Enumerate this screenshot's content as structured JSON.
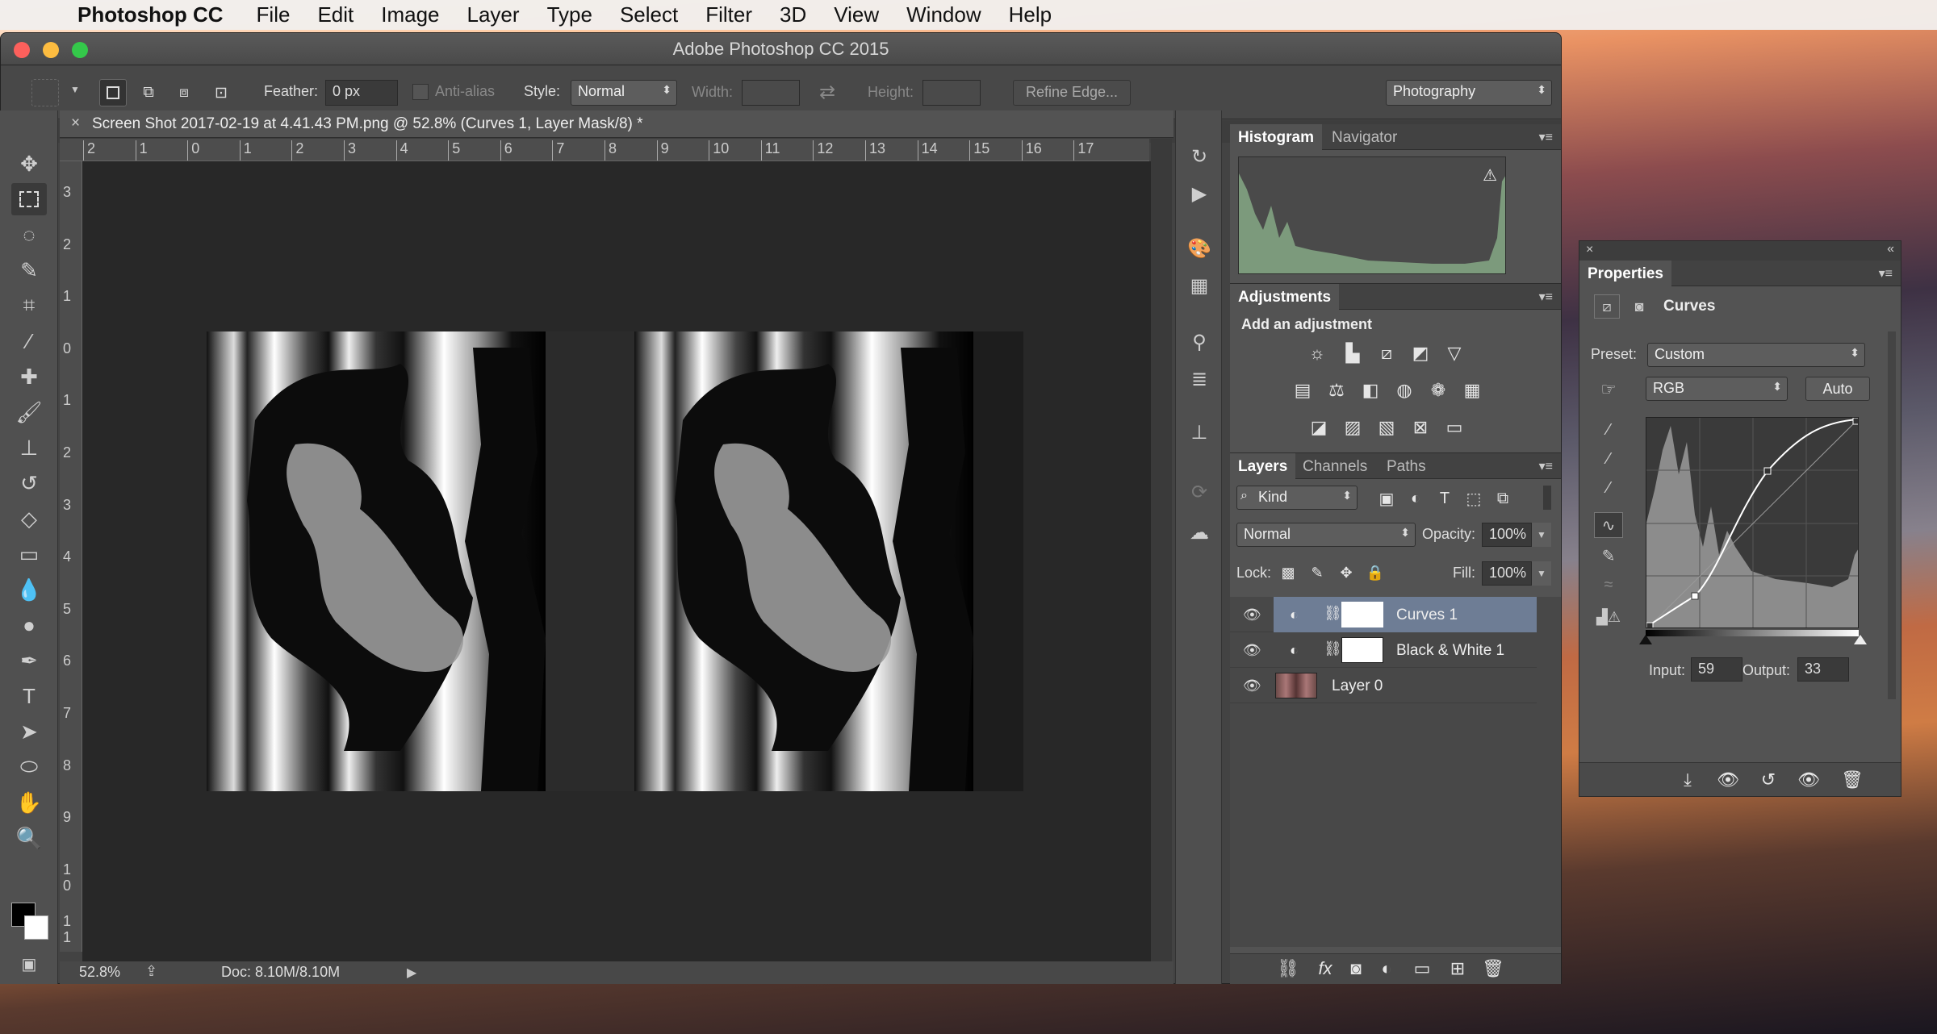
{
  "menubar": {
    "app": "Photoshop CC",
    "items": [
      "File",
      "Edit",
      "Image",
      "Layer",
      "Type",
      "Select",
      "Filter",
      "3D",
      "View",
      "Window",
      "Help"
    ]
  },
  "window": {
    "title": "Adobe Photoshop CC 2015"
  },
  "options": {
    "feather_label": "Feather:",
    "feather_value": "0 px",
    "antialias_label": "Anti-alias",
    "style_label": "Style:",
    "style_value": "Normal",
    "width_label": "Width:",
    "height_label": "Height:",
    "refine_edge": "Refine Edge...",
    "workspace": "Photography"
  },
  "document": {
    "tab": "Screen Shot 2017-02-19 at 4.41.43 PM.png @ 52.8% (Curves 1, Layer Mask/8) *",
    "zoom": "52.8%",
    "doc_size": "Doc: 8.10M/8.10M"
  },
  "ruler": {
    "h": [
      "2",
      "1",
      "0",
      "1",
      "2",
      "3",
      "4",
      "5",
      "6",
      "7",
      "8",
      "9",
      "10",
      "11",
      "12",
      "13",
      "14",
      "15",
      "16",
      "17"
    ],
    "v": [
      "3",
      "2",
      "1",
      "0",
      "1",
      "2",
      "3",
      "4",
      "5",
      "6",
      "7",
      "8",
      "9",
      "1\n0",
      "1\n1"
    ]
  },
  "histogram": {
    "tabs": [
      "Histogram",
      "Navigator"
    ]
  },
  "adjustments": {
    "title": "Adjustments",
    "subtitle": "Add an adjustment"
  },
  "layers": {
    "tabs": [
      "Layers",
      "Channels",
      "Paths"
    ],
    "filter": "Kind",
    "blend": "Normal",
    "opacity_label": "Opacity:",
    "opacity": "100%",
    "lock_label": "Lock:",
    "fill_label": "Fill:",
    "fill": "100%",
    "items": [
      {
        "name": "Curves 1",
        "selected": true
      },
      {
        "name": "Black & White 1",
        "selected": false
      },
      {
        "name": "Layer 0",
        "selected": false
      }
    ]
  },
  "properties": {
    "title": "Properties",
    "type": "Curves",
    "preset_label": "Preset:",
    "preset": "Custom",
    "channel": "RGB",
    "auto": "Auto",
    "input_label": "Input:",
    "input": "59",
    "output_label": "Output:",
    "output": "33"
  }
}
